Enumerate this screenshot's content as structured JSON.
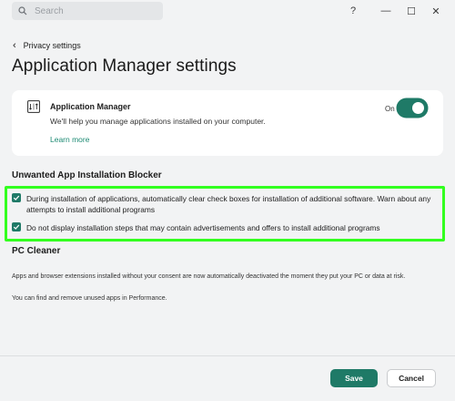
{
  "titlebar": {
    "search_placeholder": "Search",
    "help_glyph": "?",
    "minimize_glyph": "—",
    "maximize_glyph": "☐",
    "close_glyph": "✕"
  },
  "nav": {
    "back_label": "Privacy settings"
  },
  "page": {
    "title": "Application Manager settings"
  },
  "app_card": {
    "title": "Application Manager",
    "description": "We'll help you manage applications installed on your computer.",
    "link": "Learn more",
    "toggle_label": "On",
    "toggle_on": true
  },
  "blocker": {
    "title": "Unwanted App Installation Blocker",
    "options": [
      {
        "checked": true,
        "label": "During installation of applications, automatically clear check boxes for installation of additional software. Warn about any attempts to install additional programs"
      },
      {
        "checked": true,
        "label": "Do not display installation steps that may contain advertisements and offers to install additional programs"
      }
    ]
  },
  "pc_cleaner": {
    "title": "PC Cleaner",
    "text1": "Apps and browser extensions installed without your consent are now automatically deactivated the moment they put your PC or data at risk.",
    "text2": "You can find and remove unused apps in Performance."
  },
  "footer": {
    "save_label": "Save",
    "cancel_label": "Cancel"
  },
  "colors": {
    "accent": "#1f7a67",
    "link": "#1c8a73",
    "highlight": "#33ff1f",
    "background": "#f2f3f4"
  }
}
